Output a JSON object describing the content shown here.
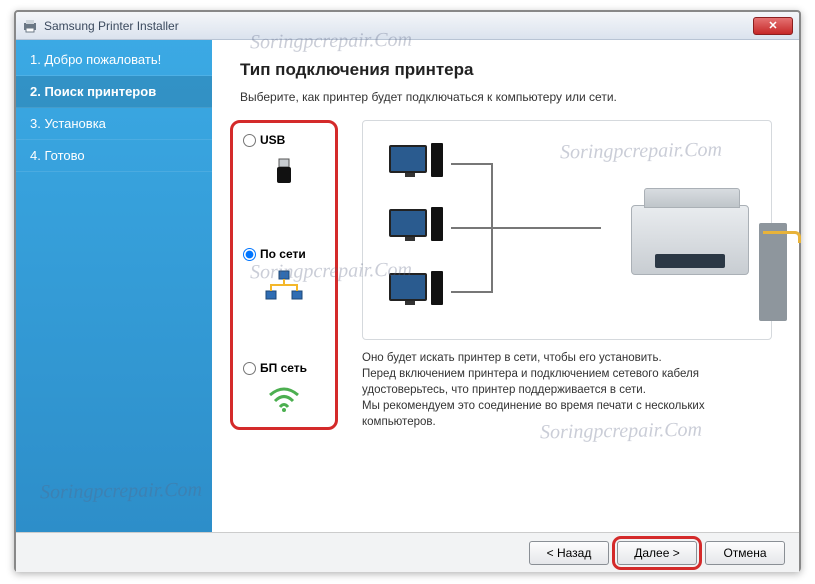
{
  "window": {
    "title": "Samsung Printer Installer"
  },
  "sidebar": {
    "items": [
      {
        "label": "1. Добро пожаловать!"
      },
      {
        "label": "2. Поиск принтеров"
      },
      {
        "label": "3. Установка"
      },
      {
        "label": "4. Готово"
      }
    ],
    "active_index": 1
  },
  "main": {
    "heading": "Тип подключения принтера",
    "subtitle": "Выберите, как принтер будет подключаться к компьютеру или сети."
  },
  "options": {
    "usb": {
      "label": "USB",
      "selected": false
    },
    "network": {
      "label": "По сети",
      "selected": true
    },
    "wireless": {
      "label": "БП сеть",
      "selected": false
    }
  },
  "description": {
    "line1": "Оно будет искать принтер в сети, чтобы его установить.",
    "line2": "Перед включением принтера и подключением сетевого кабеля удостоверьтесь, что принтер поддерживается в сети.",
    "line3": "Мы рекомендуем это соединение во время печати с нескольких компьютеров."
  },
  "buttons": {
    "back": "< Назад",
    "next": "Далее >",
    "cancel": "Отмена"
  },
  "watermark": "Soringpcrepair.Com"
}
